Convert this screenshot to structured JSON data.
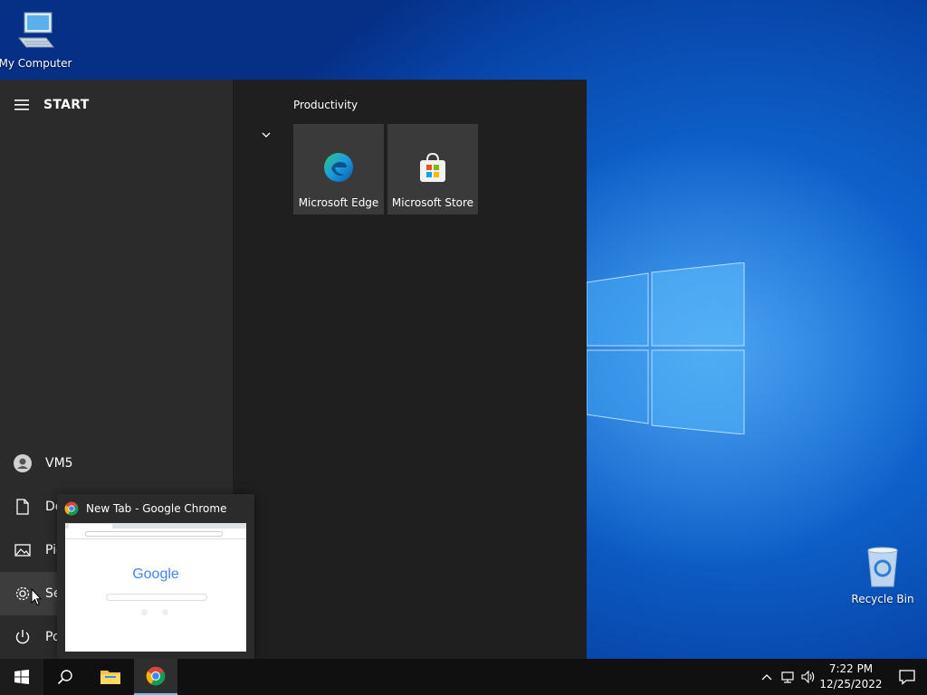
{
  "desktop": {
    "icons": [
      {
        "label": "My Computer",
        "icon": "computer-icon"
      },
      {
        "label": "Recycle Bin",
        "icon": "recycle-bin-icon"
      }
    ]
  },
  "start_menu": {
    "title": "START",
    "user": "VM5",
    "left_items": [
      {
        "label": "Documents",
        "icon": "document-icon"
      },
      {
        "label": "Pictures",
        "icon": "pictures-icon"
      },
      {
        "label": "Settings",
        "icon": "gear-icon"
      },
      {
        "label": "Power",
        "icon": "power-icon"
      }
    ],
    "group_title": "Productivity",
    "tiles": [
      {
        "label": "Microsoft Edge",
        "icon": "edge-icon"
      },
      {
        "label": "Microsoft Store",
        "icon": "store-icon"
      }
    ]
  },
  "preview": {
    "title": "New Tab - Google Chrome",
    "logo_text": "Google"
  },
  "taskbar": {
    "items": [
      "windows-start-icon",
      "search-icon",
      "file-explorer-icon",
      "chrome-icon"
    ],
    "time": "7:22 PM",
    "date": "12/25/2022"
  },
  "colors": {
    "accent": "#76b9ed",
    "start_bg": "#1f1f1f",
    "start_left_bg": "#2b2b2b",
    "tile_bg": "#3a3a3a",
    "taskbar_bg": "#101010"
  }
}
